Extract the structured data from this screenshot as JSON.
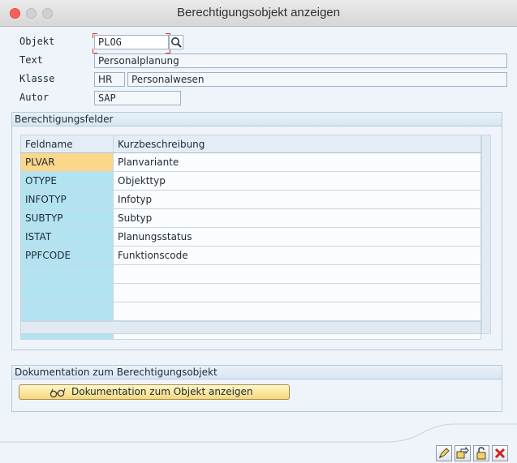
{
  "window": {
    "title": "Berechtigungsobjekt anzeigen"
  },
  "header": {
    "objekt_label": "Objekt",
    "objekt_value": "PLOG",
    "text_label": "Text",
    "text_value": "Personalplanung",
    "klasse_label": "Klasse",
    "klasse_code": "HR",
    "klasse_name": "Personalwesen",
    "autor_label": "Autor",
    "autor_value": "SAP"
  },
  "fields_group": {
    "title": "Berechtigungsfelder",
    "columns": [
      "Feldname",
      "Kurzbeschreibung"
    ],
    "rows": [
      {
        "name": "PLVAR",
        "desc": "Planvariante"
      },
      {
        "name": "OTYPE",
        "desc": "Objekttyp"
      },
      {
        "name": "INFOTYP",
        "desc": "Infotyp"
      },
      {
        "name": "SUBTYP",
        "desc": "Subtyp"
      },
      {
        "name": "ISTAT",
        "desc": "Planungsstatus"
      },
      {
        "name": "PPFCODE",
        "desc": "Funktionscode"
      },
      {
        "name": "",
        "desc": ""
      },
      {
        "name": "",
        "desc": ""
      },
      {
        "name": "",
        "desc": ""
      },
      {
        "name": "",
        "desc": ""
      }
    ]
  },
  "doc_group": {
    "title": "Dokumentation zum Berechtigungsobjekt",
    "button_label": "Dokumentation zum Objekt anzeigen"
  },
  "icons": {
    "search": "search-icon",
    "doc_button": "glasses-icon",
    "footer": [
      "edit-icon",
      "transfer-icon",
      "unlock-icon",
      "cancel-icon"
    ]
  },
  "colors": {
    "key_cell": "#b3e3f1",
    "selected_cell": "#fbd78a",
    "button_yellow": "#f6d87a",
    "cancel_red": "#d22020"
  }
}
